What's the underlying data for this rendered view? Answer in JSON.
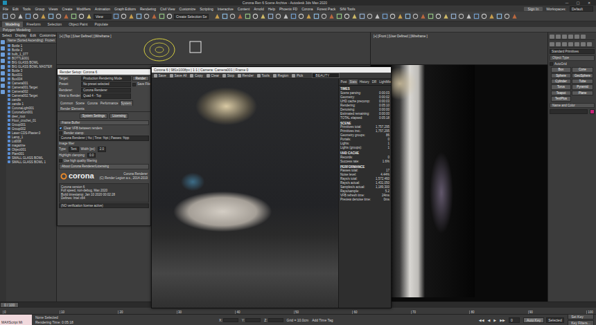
{
  "window": {
    "title": "Corona Ren 6 Scene Archive - Autodesk 3ds Max 2020",
    "controls": [
      "—",
      "□",
      "✕"
    ]
  },
  "menu": [
    "File",
    "Edit",
    "Tools",
    "Group",
    "Views",
    "Create",
    "Modifiers",
    "Animation",
    "Graph Editors",
    "Rendering",
    "Civil View",
    "Customize",
    "Scripting",
    "Interactive",
    "Content",
    "Arnold",
    "Help",
    "Phoenix FD",
    "Corona",
    "Forest Pack",
    "SiNi Tools"
  ],
  "sign_in": "Sign In",
  "workspace": {
    "label": "Workspaces:",
    "value": "Default"
  },
  "toolbar": {
    "view_field": "View",
    "selection_field": "Create Selection Se"
  },
  "ribbon": {
    "tabs": [
      {
        "label": "Modeling",
        "selected": true
      },
      {
        "label": "Freeform",
        "selected": false
      },
      {
        "label": "Selection",
        "selected": false
      },
      {
        "label": "Object Paint",
        "selected": false
      },
      {
        "label": "Populate",
        "selected": false
      }
    ],
    "subtitle": "Polygon Modeling"
  },
  "explorer": {
    "menu": [
      "Select",
      "Display",
      "Edit",
      "Customize"
    ],
    "column": "Name (Sorted Ascending)",
    "column2": "Frozen",
    "items": [
      {
        "name": "Bottle 1",
        "selected": false
      },
      {
        "name": "Bottle 2",
        "selected": false
      },
      {
        "name": "bulb_1_077",
        "selected": false
      },
      {
        "name": "BOTTLE001",
        "selected": false
      },
      {
        "name": "BIG GLASS BOWL",
        "selected": false
      },
      {
        "name": "BIG GLASS BOWL MASTER",
        "selected": false
      },
      {
        "name": "Bottle 3",
        "selected": false
      },
      {
        "name": "Box001",
        "selected": false
      },
      {
        "name": "Box004",
        "selected": false
      },
      {
        "name": "Camera001",
        "selected": false
      },
      {
        "name": "Camera001.Target",
        "selected": false
      },
      {
        "name": "Camera002",
        "selected": false
      },
      {
        "name": "Camera002.Target",
        "selected": false
      },
      {
        "name": "candle",
        "selected": false
      },
      {
        "name": "candle 1",
        "selected": false
      },
      {
        "name": "CoronaLight001",
        "selected": false
      },
      {
        "name": "CoronaSun001",
        "selected": false
      },
      {
        "name": "deer_root",
        "selected": false
      },
      {
        "name": "Floor_crochet_01",
        "selected": false
      },
      {
        "name": "Group001",
        "selected": false
      },
      {
        "name": "Group002",
        "selected": false
      },
      {
        "name": "Laser-CDS-Plaster.0",
        "selected": false
      },
      {
        "name": "Lamp_1",
        "selected": false
      },
      {
        "name": "Lid008",
        "selected": false
      },
      {
        "name": "magazine",
        "selected": false
      },
      {
        "name": "Object001",
        "selected": false
      },
      {
        "name": "Plant001",
        "selected": false
      },
      {
        "name": "SMALL GLASS BOWL",
        "selected": false
      },
      {
        "name": "SMALL GLASS BOWL 1",
        "selected": false
      }
    ]
  },
  "viewports": [
    {
      "label": "[+] [Top ] [User Defined ] [Wireframe ]"
    },
    {
      "label": "[+] [Front ] [User Defined ] [Wireframe ]"
    }
  ],
  "render_setup": {
    "title": "Render Setup: Corona 6",
    "fields": [
      {
        "label": "Target:",
        "value": "Production Rendering Mode"
      },
      {
        "label": "Preset:",
        "value": "No preset selected"
      },
      {
        "label": "Renderer:",
        "value": "Corona Renderer"
      },
      {
        "label": "View to Render:",
        "value": "Quad 4 - Top"
      }
    ],
    "render_button": "Render",
    "save_file": {
      "label": "Save File",
      "checked": false
    },
    "tabs": [
      {
        "label": "Common",
        "selected": false
      },
      {
        "label": "Scene",
        "selected": false
      },
      {
        "label": "Corona",
        "selected": false
      },
      {
        "label": "Performance",
        "selected": false
      },
      {
        "label": "System",
        "selected": true
      },
      {
        "label": "Render Elements",
        "selected": false
      }
    ],
    "buttons": [
      "System Settings",
      "Licensing"
    ],
    "frame_buffer": {
      "title": "Frame Buffer",
      "clear_vfb": {
        "label": "Clear VFB between renders",
        "checked": true
      },
      "stamp": {
        "label": "Render stamp:",
        "checked": false,
        "value": "Corona Renderer | %c | Time: %pt | Passes: %pp"
      },
      "filter_title": "Image filter",
      "type_label": "Type:",
      "type_value": "Tent",
      "width_label": "Width [px]:",
      "width_value": "2.0",
      "clamp_label": "Highlight clamping:",
      "clamp_value": "0.0",
      "hq": {
        "label": "Use high quality filtering",
        "checked": false
      }
    },
    "about": {
      "title": "About Corona Renderer/Licensing",
      "logo": "corona",
      "product": "Corona Renderer",
      "copyright": "(C) Render Legion a.s., 2014-2019",
      "info": [
        "Corona version 6",
        "Full speed, non-debug, Max 2020",
        "Build timestamp: Jan 10 2020 00:02:28",
        "Defines: Intel x64"
      ],
      "license": "(NO verification license active)"
    }
  },
  "vfb": {
    "title": "Corona 6 | 981x1008px | 1:1 | Camera: Camera001 | Frame 0",
    "tools": [
      "Save",
      "Save All",
      "Copy",
      "Clear",
      "Stop",
      "Render",
      "Tools",
      "Region",
      "Pick"
    ],
    "channel": "BEAUTY",
    "tabs": [
      {
        "label": "Post",
        "selected": false
      },
      {
        "label": "Stats",
        "selected": true
      },
      {
        "label": "History",
        "selected": false
      },
      {
        "label": "DR",
        "selected": false
      },
      {
        "label": "LightMix",
        "selected": false
      }
    ],
    "sections": [
      {
        "title": "TIMES",
        "rows": [
          {
            "label": "Scene parsing:",
            "value": "0:00:03"
          },
          {
            "label": "Geometry:",
            "value": "0:00:02"
          },
          {
            "label": "UHD cache precomp:",
            "value": "0:00:03"
          },
          {
            "label": "Rendering:",
            "value": "0:05:10"
          },
          {
            "label": "Denoising:",
            "value": "0:00:00"
          },
          {
            "label": "Estimated remaining:",
            "value": "0:00:00"
          },
          {
            "label": "TOTAL elapsed:",
            "value": "0:05:18"
          }
        ]
      },
      {
        "title": "SCENE",
        "rows": [
          {
            "label": "Primitives total:",
            "value": "1,757,295"
          },
          {
            "label": "Primitives inst.:",
            "value": "1,757,295"
          },
          {
            "label": "Geometry groups:",
            "value": "86"
          },
          {
            "label": "Portals:",
            "value": "0"
          },
          {
            "label": "Lights:",
            "value": "1"
          },
          {
            "label": "Lights (groups):",
            "value": "1"
          }
        ]
      },
      {
        "title": "UHD CACHE",
        "rows": [
          {
            "label": "Records:",
            "value": "0"
          },
          {
            "label": "Success rate:",
            "value": "1.6%"
          }
        ]
      },
      {
        "title": "PERFORMANCE",
        "rows": [
          {
            "label": "Passes total:",
            "value": "17"
          },
          {
            "label": "Noise level:",
            "value": "4.44%"
          },
          {
            "label": "Rays/s total:",
            "value": "1,572,460"
          },
          {
            "label": "Rays/s actual:",
            "value": "1,431,050"
          },
          {
            "label": "Samples/s actual:",
            "value": "1,189,300"
          },
          {
            "label": "Rays/sample:",
            "value": "5.2"
          },
          {
            "label": "VFB refresh time:",
            "value": "24ms"
          },
          {
            "label": "Preview denoise time:",
            "value": "0ms"
          }
        ]
      }
    ]
  },
  "command_panel": {
    "dropdown": "Standard Primitives",
    "object_type": "Object Type",
    "autogrid": {
      "label": "AutoGrid",
      "checked": false
    },
    "buttons": [
      "Box",
      "Cone",
      "Sphere",
      "GeoSphere",
      "Cylinder",
      "Tube",
      "Torus",
      "Pyramid",
      "Teapot",
      "Plane",
      "TextPlus"
    ],
    "name_and_color": "Name and Color",
    "swatch": "#c8267a"
  },
  "timeline": {
    "position": "0 / 100",
    "ticks": [
      "0",
      "10",
      "20",
      "30",
      "40",
      "50",
      "60",
      "70",
      "80",
      "90",
      "100"
    ]
  },
  "status_bar": {
    "script": "MAXScript Mi",
    "selection": "None Selected",
    "render_time": "Rendering Time: 0:05:18",
    "coords": [
      "X:",
      "Y:",
      "Z:"
    ],
    "grid": "Grid = 10.0cm",
    "time_tag": "Add Time Tag",
    "playback": [
      "◀◀",
      "◀",
      "▶",
      "▶▶"
    ],
    "frame": "0",
    "auto_key": "Auto Key",
    "key_mode": "Selected",
    "set_key": "Set Key",
    "key_filters": "Key Filters..."
  }
}
